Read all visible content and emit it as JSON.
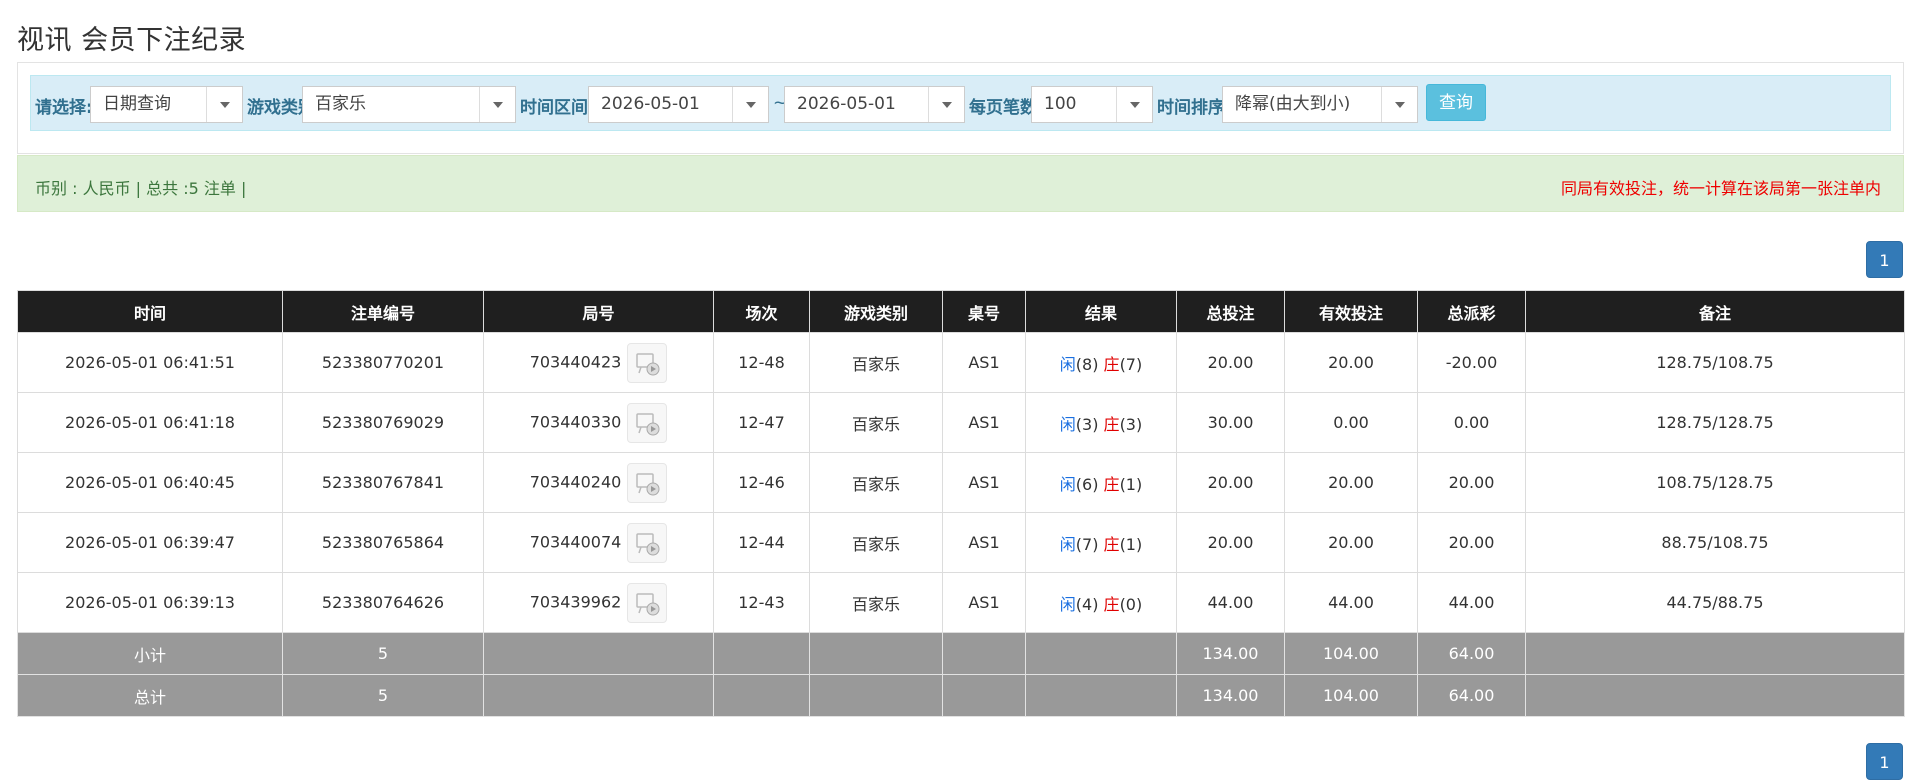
{
  "page_title": "视讯 会员下注纪录",
  "filter": {
    "select_label": "请选择:",
    "select_value": "日期查询",
    "game_type_label": "游戏类别",
    "game_type_value": "百家乐",
    "time_range_label": "时间区间:",
    "date_from": "2026-05-01",
    "tilde": "~",
    "date_to": "2026-05-01",
    "per_page_label": "每页笔数 :",
    "per_page_value": "100",
    "sort_label": "时间排序 :",
    "sort_value": "降幂(由大到小)",
    "query_button": "查询"
  },
  "summary": {
    "left": "币别 : 人民币 | 总共 :5 注单 |",
    "right": "同局有效投注，统一计算在该局第一张注单内"
  },
  "pagination": {
    "current": "1"
  },
  "table": {
    "headers": [
      "时间",
      "注单编号",
      "局号",
      "场次",
      "游戏类别",
      "桌号",
      "结果",
      "总投注",
      "有效投注",
      "总派彩",
      "备注"
    ],
    "rows": [
      {
        "time": "2026-05-01 06:41:51",
        "bet_no": "523380770201",
        "round": "703440423",
        "session": "12-48",
        "game": "百家乐",
        "table": "AS1",
        "player_label": "闲",
        "player_pts": "(8)",
        "banker_label": "庄",
        "banker_pts": "(7)",
        "total_bet": "20.00",
        "valid_bet": "20.00",
        "payout": "-20.00",
        "payout_negative": true,
        "note": "128.75/108.75"
      },
      {
        "time": "2026-05-01 06:41:18",
        "bet_no": "523380769029",
        "round": "703440330",
        "session": "12-47",
        "game": "百家乐",
        "table": "AS1",
        "player_label": "闲",
        "player_pts": "(3)",
        "banker_label": "庄",
        "banker_pts": "(3)",
        "total_bet": "30.00",
        "valid_bet": "0.00",
        "payout": "0.00",
        "payout_negative": false,
        "note": "128.75/128.75"
      },
      {
        "time": "2026-05-01 06:40:45",
        "bet_no": "523380767841",
        "round": "703440240",
        "session": "12-46",
        "game": "百家乐",
        "table": "AS1",
        "player_label": "闲",
        "player_pts": "(6)",
        "banker_label": "庄",
        "banker_pts": "(1)",
        "total_bet": "20.00",
        "valid_bet": "20.00",
        "payout": "20.00",
        "payout_negative": false,
        "note": "108.75/128.75"
      },
      {
        "time": "2026-05-01 06:39:47",
        "bet_no": "523380765864",
        "round": "703440074",
        "session": "12-44",
        "game": "百家乐",
        "table": "AS1",
        "player_label": "闲",
        "player_pts": "(7)",
        "banker_label": "庄",
        "banker_pts": "(1)",
        "total_bet": "20.00",
        "valid_bet": "20.00",
        "payout": "20.00",
        "payout_negative": false,
        "note": "88.75/108.75"
      },
      {
        "time": "2026-05-01 06:39:13",
        "bet_no": "523380764626",
        "round": "703439962",
        "session": "12-43",
        "game": "百家乐",
        "table": "AS1",
        "player_label": "闲",
        "player_pts": "(4)",
        "banker_label": "庄",
        "banker_pts": "(0)",
        "total_bet": "44.00",
        "valid_bet": "44.00",
        "payout": "44.00",
        "payout_negative": false,
        "note": "44.75/88.75"
      }
    ],
    "subtotal": {
      "label": "小计",
      "count": "5",
      "total_bet": "134.00",
      "valid_bet": "104.00",
      "payout": "64.00"
    },
    "total": {
      "label": "总计",
      "count": "5",
      "total_bet": "134.00",
      "valid_bet": "104.00",
      "payout": "64.00"
    }
  },
  "colors": {
    "header_bg": "#1f1f1f",
    "filter_bg": "#d9edf7",
    "summary_bg": "#dff0d8",
    "player_blue": "#1a6fe0",
    "banker_red": "#e00000",
    "total_row_bg": "#999999",
    "button_primary": "#337ab7",
    "button_info": "#5bc0de"
  },
  "icons": {
    "round_video": "video-replay-icon",
    "dropdown": "caret-down-icon"
  }
}
